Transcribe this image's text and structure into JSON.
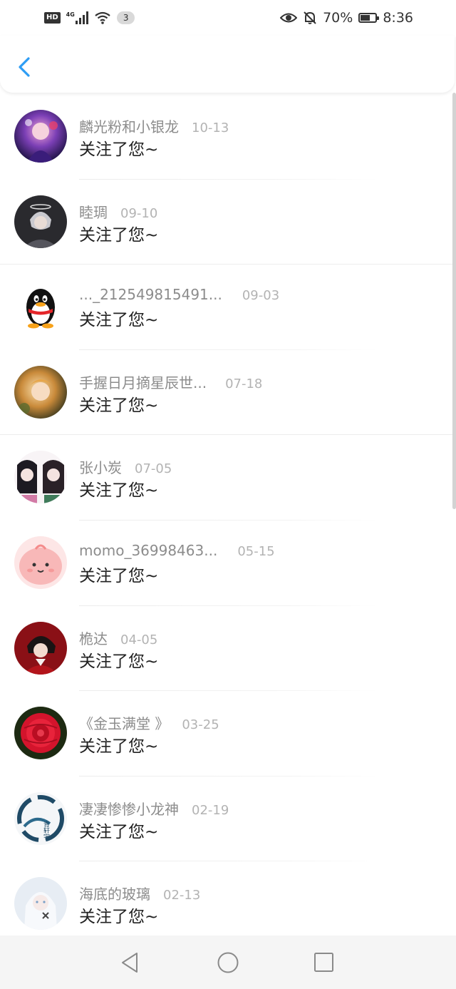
{
  "status_bar": {
    "hd": "HD",
    "network": "4G",
    "sim_count": "3",
    "battery_percent": "70%",
    "battery_level": 0.7,
    "time": "8:36",
    "icons": [
      "hd-icon",
      "signal-icon",
      "wifi-icon",
      "eye-icon",
      "bell-off-icon",
      "battery-icon"
    ]
  },
  "header": {
    "back_icon": "chevron-left-icon",
    "accent_color": "#2e9df4"
  },
  "notifications": [
    {
      "name": "麟光粉和小银龙",
      "date": "10-13",
      "message": "关注了您~"
    },
    {
      "name": "睦琱",
      "date": "09-10",
      "message": "关注了您~"
    },
    {
      "name": "..._212549815491...",
      "date": "09-03",
      "message": "关注了您~"
    },
    {
      "name": "手握日月摘星辰世...",
      "date": "07-18",
      "message": "关注了您~"
    },
    {
      "name": "张小炭",
      "date": "07-05",
      "message": "关注了您~"
    },
    {
      "name": "momo_36998463...",
      "date": "05-15",
      "message": "关注了您~"
    },
    {
      "name": "桅达",
      "date": "04-05",
      "message": "关注了您~"
    },
    {
      "name": "《金玉满堂 》",
      "date": "03-25",
      "message": "关注了您~"
    },
    {
      "name": "凄凄惨惨小龙神",
      "date": "02-19",
      "message": "关注了您~"
    },
    {
      "name": "海底的玻璃",
      "date": "02-13",
      "message": "关注了您~"
    }
  ],
  "avatar_seal_text": "青轩宇",
  "navbar": {
    "icons": [
      "back-triangle-icon",
      "home-circle-icon",
      "recents-square-icon"
    ]
  }
}
